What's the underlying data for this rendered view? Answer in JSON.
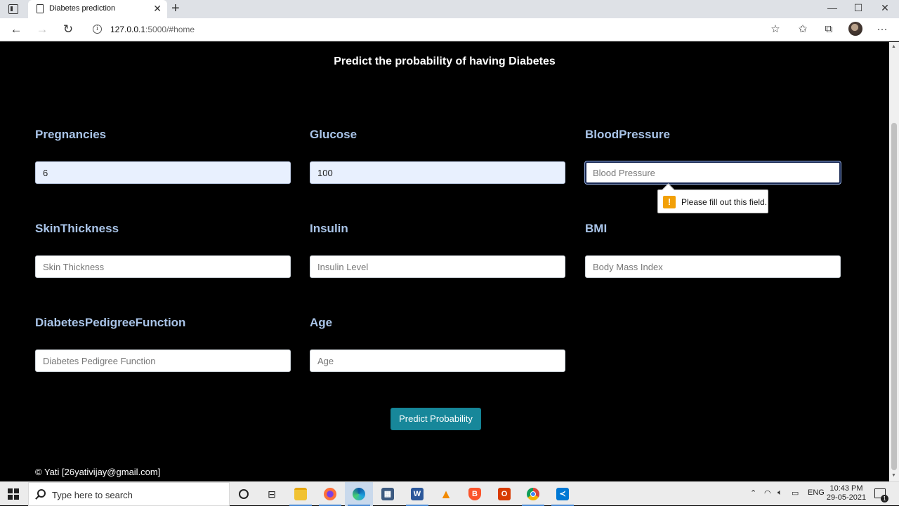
{
  "browser": {
    "tab_title": "Diabetes prediction",
    "tab_close": "✕",
    "new_tab": "+",
    "url_host": "127.0.0.1",
    "url_rest": ":5000/#home",
    "back": "←",
    "forward": "→",
    "reload": "↻",
    "minimize": "—",
    "maximize": "☐",
    "close": "✕",
    "more": "···"
  },
  "page": {
    "heading": "Predict the probability of having Diabetes",
    "fields": [
      {
        "label": "Pregnancies",
        "value": "6",
        "placeholder": ""
      },
      {
        "label": "Glucose",
        "value": "100",
        "placeholder": ""
      },
      {
        "label": "BloodPressure",
        "value": "",
        "placeholder": "Blood Pressure"
      },
      {
        "label": "SkinThickness",
        "value": "",
        "placeholder": "Skin Thickness"
      },
      {
        "label": "Insulin",
        "value": "",
        "placeholder": "Insulin Level"
      },
      {
        "label": "BMI",
        "value": "",
        "placeholder": "Body Mass Index"
      },
      {
        "label": "DiabetesPedigreeFunction",
        "value": "",
        "placeholder": "Diabetes Pedigree Function"
      },
      {
        "label": "Age",
        "value": "",
        "placeholder": "Age"
      }
    ],
    "validation_message": "Please fill out this field.",
    "validation_icon": "!",
    "submit_label": "Predict Probability",
    "footer": "© Yati [26yativijay@gmail.com]"
  },
  "taskbar": {
    "search_placeholder": "Type here to search",
    "language": "ENG",
    "time": "10:43 PM",
    "date": "29-05-2021",
    "notification_count": "1"
  },
  "colors": {
    "page_background": "#000000",
    "label_color": "#a9c4e8",
    "button_color": "#17879a",
    "warning_color": "#f2a007"
  }
}
